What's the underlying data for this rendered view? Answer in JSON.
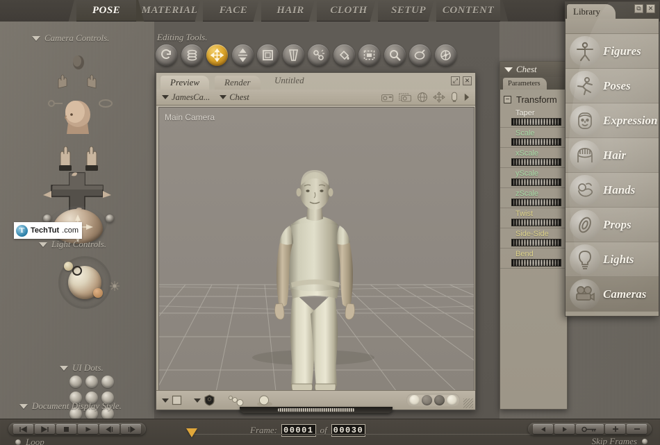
{
  "app": {
    "rooms": [
      {
        "label": "POSE",
        "active": true
      },
      {
        "label": "MATERIAL",
        "active": false
      },
      {
        "label": "FACE",
        "active": false
      },
      {
        "label": "HAIR",
        "active": false
      },
      {
        "label": "CLOTH",
        "active": false
      },
      {
        "label": "SETUP",
        "active": false
      },
      {
        "label": "CONTENT",
        "active": false
      }
    ]
  },
  "left_panel": {
    "camera_controls_label": "Camera Controls.",
    "light_controls_label": "Light Controls.",
    "ui_dots_label": "UI Dots.",
    "document_display_style_label": "Document Display Style."
  },
  "watermark": {
    "mark": "T",
    "text_bold": "TechTut",
    "text_rest": ".com"
  },
  "editing_tools": {
    "label": "Editing Tools.",
    "tools": [
      {
        "name": "rotate-tool",
        "active": false
      },
      {
        "name": "twist-tool",
        "active": false
      },
      {
        "name": "translate-pull-tool",
        "active": true
      },
      {
        "name": "translate-in-out-tool",
        "active": false
      },
      {
        "name": "scale-tool",
        "active": false
      },
      {
        "name": "taper-tool",
        "active": false
      },
      {
        "name": "chain-break-tool",
        "active": false
      },
      {
        "name": "color-fill-tool",
        "active": false
      },
      {
        "name": "grouping-tool",
        "active": false
      },
      {
        "name": "view-magnifier-tool",
        "active": false
      },
      {
        "name": "morph-putty-tool",
        "active": false
      },
      {
        "name": "direct-manipulation-tool",
        "active": false
      }
    ]
  },
  "document": {
    "tabs": [
      {
        "label": "Preview",
        "active": true
      },
      {
        "label": "Render",
        "active": false
      }
    ],
    "title": "Untitled",
    "maximize_glyph": "⤢",
    "close_glyph": "✕",
    "figure_selector": "JamesCa...",
    "actor_selector": "Chest",
    "camera_label": "Main Camera",
    "header_icons": [
      "camera-icon",
      "camera-dashed-icon",
      "globe-icon",
      "move-cross-icon",
      "light-icon",
      "flyout-arrow-icon"
    ],
    "bottom_icons": [
      "document-style-dropdown",
      "figure-style-dropdown",
      "tracking-balls-icon",
      "shadow-sphere-icon"
    ],
    "display_styles": [
      {
        "name": "smooth-shaded-style",
        "color": "#ded8c9"
      },
      {
        "name": "flat-shaded-style",
        "color": "#7b756b"
      },
      {
        "name": "texture-shaded-style",
        "color": "#6b655c"
      },
      {
        "name": "cartoon-style",
        "color": "#ded8c9"
      }
    ]
  },
  "parameters": {
    "actor_name": "Chest",
    "tab_label": "Parameters",
    "group_expander": "−",
    "group_label": "Transform",
    "dials": [
      {
        "label": "Taper",
        "color": "#f2efe6"
      },
      {
        "label": "Scale",
        "color": "#a9d9a6"
      },
      {
        "label": "xScale",
        "color": "#a9d9a6"
      },
      {
        "label": "yScale",
        "color": "#a9d9a6"
      },
      {
        "label": "zScale",
        "color": "#a9d9a6"
      },
      {
        "label": "Twist",
        "color": "#dbd18a"
      },
      {
        "label": "Side-Side",
        "color": "#dbd18a"
      },
      {
        "label": "Bend",
        "color": "#dbd18a"
      }
    ]
  },
  "library": {
    "tab_label": "Library",
    "maximize_glyph": "⧉",
    "close_glyph": "✕",
    "items": [
      {
        "label": "Figures",
        "icon": "figure-icon",
        "selected": false
      },
      {
        "label": "Poses",
        "icon": "running-icon",
        "selected": false
      },
      {
        "label": "Expression",
        "icon": "face-icon",
        "selected": false
      },
      {
        "label": "Hair",
        "icon": "hair-icon",
        "selected": false
      },
      {
        "label": "Hands",
        "icon": "hand-icon",
        "selected": false
      },
      {
        "label": "Props",
        "icon": "prop-ring-icon",
        "selected": false
      },
      {
        "label": "Lights",
        "icon": "bulb-icon",
        "selected": false
      },
      {
        "label": "Cameras",
        "icon": "camera-reel-icon",
        "selected": true
      }
    ]
  },
  "animation_bar": {
    "transport": [
      {
        "name": "go-to-start-button",
        "glyph": "⏮"
      },
      {
        "name": "go-to-end-button",
        "glyph": "⏭"
      },
      {
        "name": "stop-button",
        "glyph": "■"
      },
      {
        "name": "play-button",
        "glyph": "▶"
      },
      {
        "name": "step-back-button",
        "glyph": "◀|"
      },
      {
        "name": "step-forward-button",
        "glyph": "|▶"
      }
    ],
    "loop_label": "Loop",
    "frame_label": "Frame:",
    "frame_current": "00001",
    "frame_of": "of",
    "frame_total": "00030",
    "keyframe_buttons": [
      {
        "name": "prev-keyframe-button",
        "glyph": "◀"
      },
      {
        "name": "next-keyframe-button",
        "glyph": "▶"
      },
      {
        "name": "edit-keyframes-button",
        "glyph": "key"
      },
      {
        "name": "add-keyframe-button",
        "glyph": "+"
      },
      {
        "name": "delete-keyframe-button",
        "glyph": "−"
      }
    ],
    "skip_frames_label": "Skip Frames"
  }
}
